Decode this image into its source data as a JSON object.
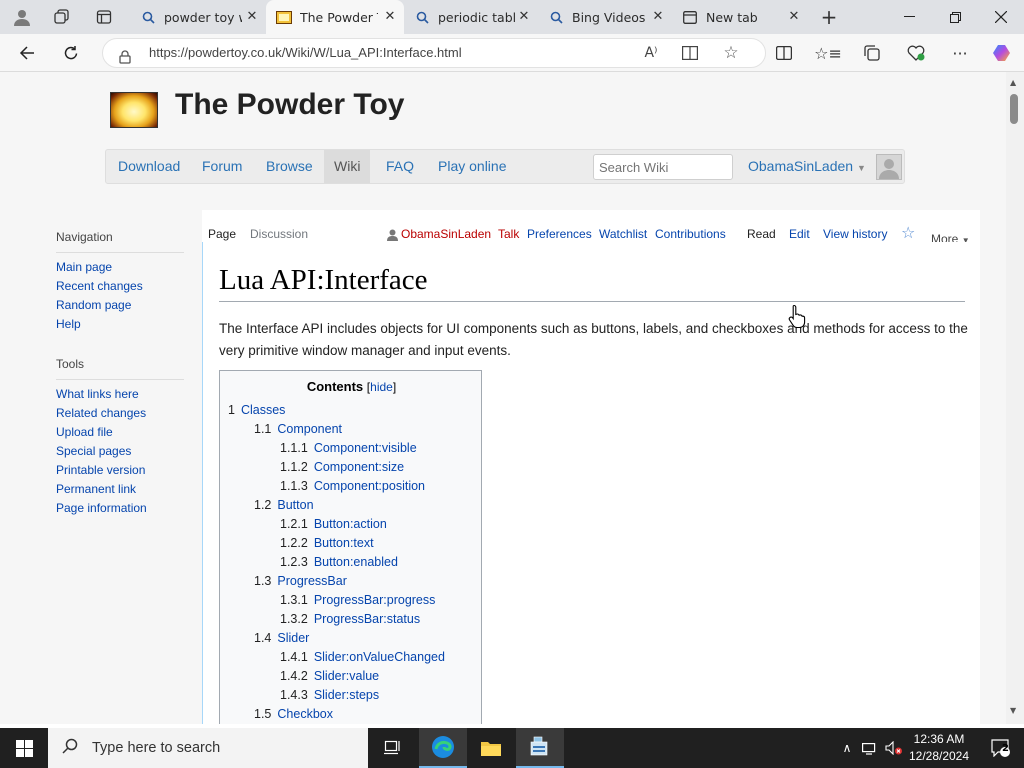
{
  "browser": {
    "tabs": [
      {
        "label": "powder toy w",
        "icon": "search-icon",
        "active": false
      },
      {
        "label": "The Powder To",
        "icon": "powder-toy-favicon-icon",
        "active": true
      },
      {
        "label": "periodic table",
        "icon": "search-icon",
        "active": false
      },
      {
        "label": "Bing Videos",
        "icon": "search-icon",
        "active": false
      },
      {
        "label": "New tab",
        "icon": "new-tab-icon",
        "active": false
      }
    ],
    "url": "https://powdertoy.co.uk/Wiki/W/Lua_API:Interface.html"
  },
  "site": {
    "title": "The Powder Toy",
    "nav": [
      "Download",
      "Forum",
      "Browse",
      "Wiki",
      "FAQ",
      "Play online"
    ],
    "current_nav": "Wiki",
    "search_placeholder": "Search Wiki",
    "user": "ObamaSinLaden"
  },
  "wiki": {
    "page_tabs": {
      "page": "Page",
      "discussion": "Discussion"
    },
    "personal": {
      "user": "ObamaSinLaden",
      "talk": "Talk",
      "preferences": "Preferences",
      "watchlist": "Watchlist",
      "contributions": "Contributions"
    },
    "view_tabs": {
      "read": "Read",
      "edit": "Edit",
      "history": "View history",
      "more": "More"
    },
    "sidebar": {
      "navigation_heading": "Navigation",
      "navigation": [
        "Main page",
        "Recent changes",
        "Random page",
        "Help"
      ],
      "tools_heading": "Tools",
      "tools": [
        "What links here",
        "Related changes",
        "Upload file",
        "Special pages",
        "Printable version",
        "Permanent link",
        "Page information"
      ]
    },
    "title": "Lua API:Interface",
    "intro": "The Interface API includes objects for UI components such as buttons, labels, and checkboxes and methods for access to the very primitive window manager and input events.",
    "toc": {
      "heading": "Contents",
      "hide": "hide",
      "items": [
        {
          "num": "1",
          "text": "Classes",
          "level": 1
        },
        {
          "num": "1.1",
          "text": "Component",
          "level": 2
        },
        {
          "num": "1.1.1",
          "text": "Component:visible",
          "level": 3
        },
        {
          "num": "1.1.2",
          "text": "Component:size",
          "level": 3
        },
        {
          "num": "1.1.3",
          "text": "Component:position",
          "level": 3
        },
        {
          "num": "1.2",
          "text": "Button",
          "level": 2
        },
        {
          "num": "1.2.1",
          "text": "Button:action",
          "level": 3
        },
        {
          "num": "1.2.2",
          "text": "Button:text",
          "level": 3
        },
        {
          "num": "1.2.3",
          "text": "Button:enabled",
          "level": 3
        },
        {
          "num": "1.3",
          "text": "ProgressBar",
          "level": 2
        },
        {
          "num": "1.3.1",
          "text": "ProgressBar:progress",
          "level": 3
        },
        {
          "num": "1.3.2",
          "text": "ProgressBar:status",
          "level": 3
        },
        {
          "num": "1.4",
          "text": "Slider",
          "level": 2
        },
        {
          "num": "1.4.1",
          "text": "Slider:onValueChanged",
          "level": 3
        },
        {
          "num": "1.4.2",
          "text": "Slider:value",
          "level": 3
        },
        {
          "num": "1.4.3",
          "text": "Slider:steps",
          "level": 3
        },
        {
          "num": "1.5",
          "text": "Checkbox",
          "level": 2
        }
      ]
    }
  },
  "taskbar": {
    "search_placeholder": "Type here to search",
    "time": "12:36 AM",
    "date": "12/28/2024",
    "notifications": "2"
  }
}
